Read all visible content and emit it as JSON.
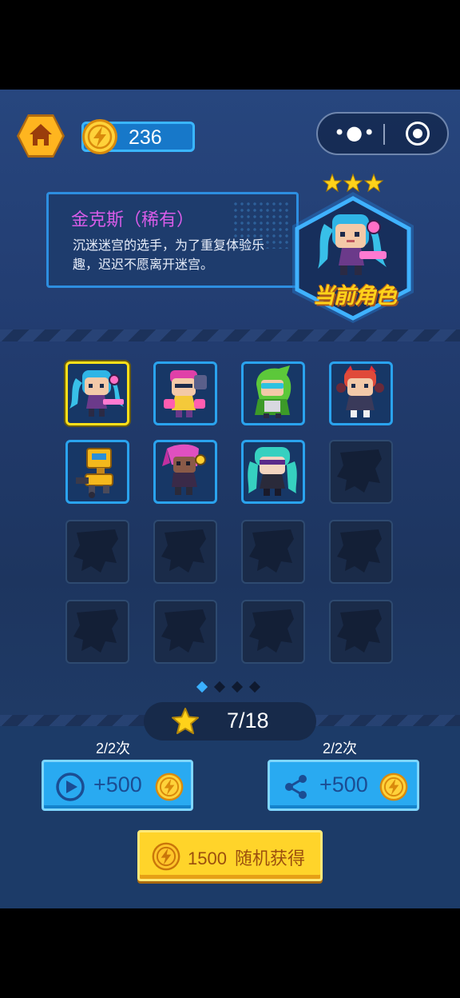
{
  "header": {
    "coin_amount": "236"
  },
  "character": {
    "name": "金克斯（稀有）",
    "description": "沉迷迷宫的选手，为了重复体验乐趣，迟迟不愿离开迷宫。",
    "star_count": 3,
    "current_label": "当前角色"
  },
  "roster": {
    "slots": [
      {
        "state": "selected",
        "hero": "jinx"
      },
      {
        "state": "unlocked",
        "hero": "vi"
      },
      {
        "state": "unlocked",
        "hero": "green-hood"
      },
      {
        "state": "unlocked",
        "hero": "annie"
      },
      {
        "state": "unlocked",
        "hero": "yellow-robot"
      },
      {
        "state": "unlocked",
        "hero": "pink-hair-girl"
      },
      {
        "state": "unlocked",
        "hero": "teal-hair-girl"
      },
      {
        "state": "locked"
      },
      {
        "state": "locked"
      },
      {
        "state": "locked"
      },
      {
        "state": "locked"
      },
      {
        "state": "locked"
      },
      {
        "state": "locked"
      },
      {
        "state": "locked"
      },
      {
        "state": "locked"
      },
      {
        "state": "locked"
      }
    ],
    "page_count": 4,
    "active_page": 1
  },
  "collection": {
    "count": "7/18"
  },
  "rewards": {
    "video": {
      "quota": "2/2次",
      "value": "+500"
    },
    "share": {
      "quota": "2/2次",
      "value": "+500"
    }
  },
  "random_draw": {
    "cost": "1500",
    "label": "随机获得"
  },
  "colors": {
    "accent_blue": "#2aa3ee",
    "selection_yellow": "#ffe019",
    "name_purple": "#d85ce8",
    "coin_gold": "#ffd42a"
  }
}
